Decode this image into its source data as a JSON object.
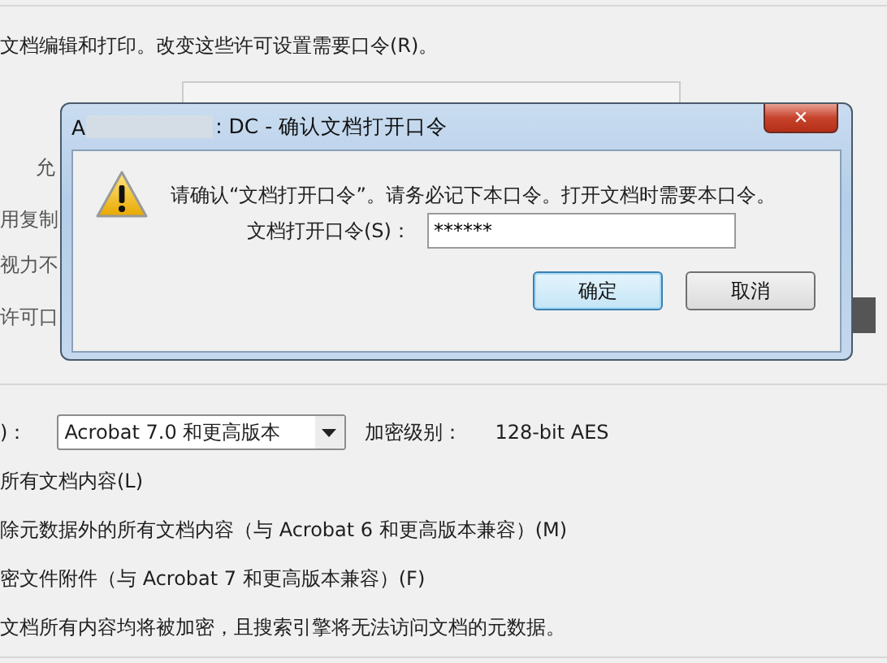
{
  "background": {
    "intro": "文档编辑和打印。改变这些许可设置需要口令(R)。",
    "fragments": [
      "允",
      "用复制",
      "视力不",
      "许可口"
    ],
    "compat_label": ")：",
    "compat_value": "Acrobat 7.0 和更高版本",
    "level_label": "加密级别：",
    "level_value": "128-bit AES",
    "options": [
      "所有文档内容(L)",
      "除元数据外的所有文档内容（与 Acrobat 6 和更高版本兼容）(M)",
      "密文件附件（与 Acrobat 7 和更高版本兼容）(F)"
    ],
    "note": "文档所有内容均将被加密，且搜索引擎将无法访问文档的元数据。"
  },
  "dialog": {
    "title_start": "A",
    "title_end": ": DC - 确认文档打开口令",
    "close": "✕",
    "message": "请确认“文档打开口令”。请务必记下本口令。打开文档时需要本口令。",
    "field_label": "文档打开口令(S)：",
    "field_value": "******",
    "buttons": [
      {
        "label": "确定",
        "selected": true
      },
      {
        "label": "取消",
        "selected": false
      }
    ]
  }
}
